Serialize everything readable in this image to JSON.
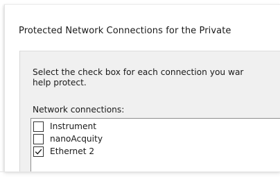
{
  "dialog": {
    "title": "Protected Network Connections for the Private"
  },
  "instructions": {
    "line1": "Select the check box for each connection you war",
    "line2": "help protect."
  },
  "network_connections": {
    "label": "Network connections:",
    "items": [
      {
        "label": "Instrument",
        "checked": false
      },
      {
        "label": "nanoAcquity",
        "checked": false
      },
      {
        "label": "Ethernet 2",
        "checked": true
      }
    ]
  },
  "icons": {
    "checkmark": "checkmark-icon"
  }
}
